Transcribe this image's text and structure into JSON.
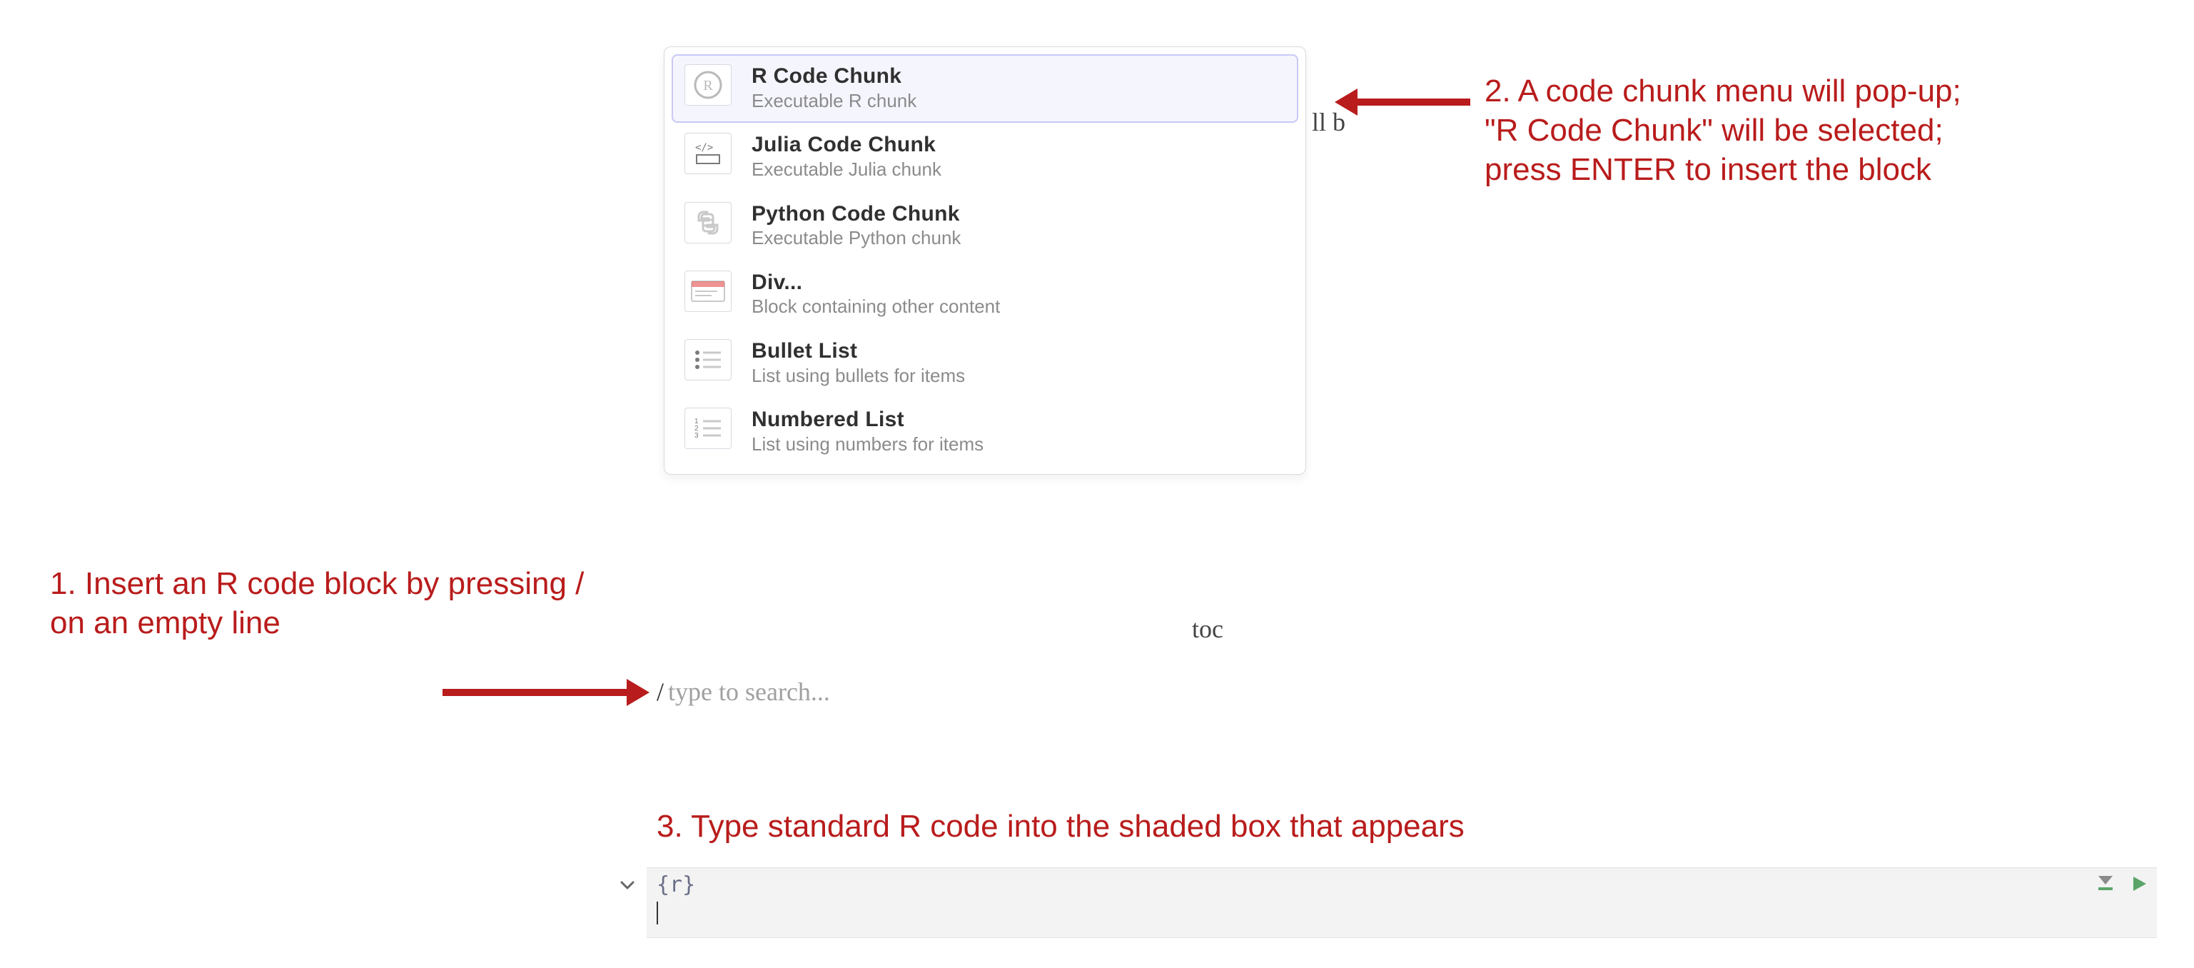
{
  "annotations": {
    "step1": "1. Insert an R code block by pressing / on an empty line",
    "step2": "2. A code chunk menu will pop-up; \"R Code Chunk\" will be selected; press ENTER to insert the block",
    "step3": "3. Type standard R code into the shaded box that appears"
  },
  "popup": {
    "items": [
      {
        "icon": "r-lang-icon",
        "title": "R Code Chunk",
        "sub": "Executable R chunk",
        "selected": true
      },
      {
        "icon": "julia-lang-icon",
        "title": "Julia Code Chunk",
        "sub": "Executable Julia chunk",
        "selected": false
      },
      {
        "icon": "python-lang-icon",
        "title": "Python Code Chunk",
        "sub": "Executable Python chunk",
        "selected": false
      },
      {
        "icon": "div-block-icon",
        "title": "Div...",
        "sub": "Block containing other content",
        "selected": false
      },
      {
        "icon": "bullet-list-icon",
        "title": "Bullet List",
        "sub": "List using bullets for items",
        "selected": false
      },
      {
        "icon": "numbered-list-icon",
        "title": "Numbered List",
        "sub": "List using numbers for items",
        "selected": false
      }
    ]
  },
  "slash": {
    "prefix": "/",
    "placeholder": "type to search..."
  },
  "code_chunk": {
    "lang_label": "{r}"
  },
  "bg_fragments": {
    "a": "ll b",
    "b": "toc"
  }
}
